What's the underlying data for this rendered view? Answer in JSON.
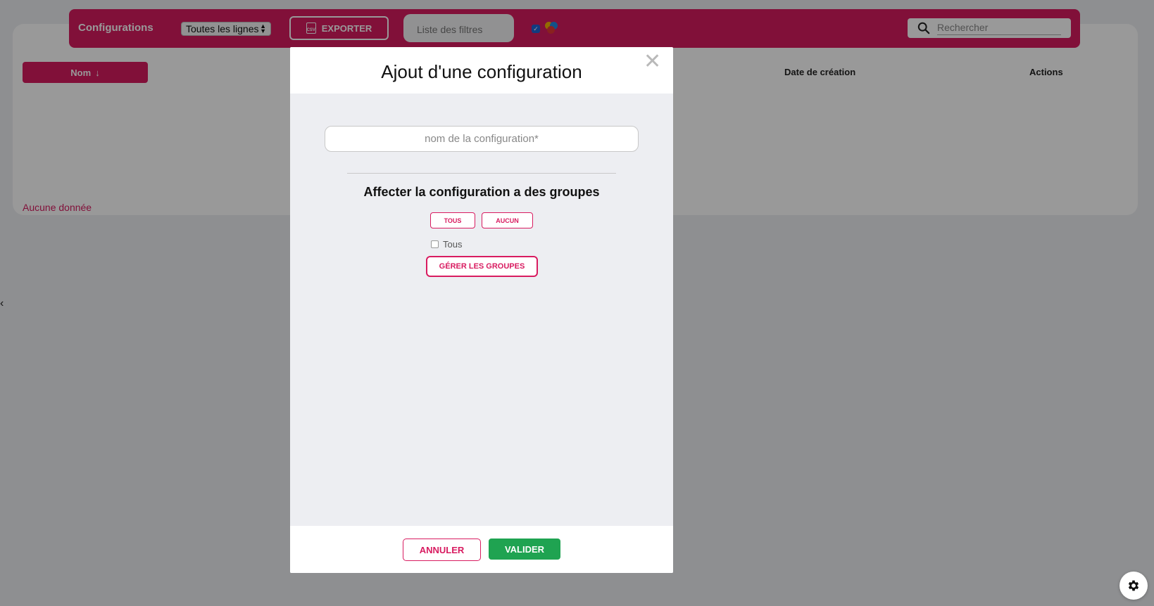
{
  "header": {
    "title": "Configurations",
    "lines_select": "Toutes les lignes",
    "export_label": "EXPORTER",
    "csv_icon_text": "CSV",
    "filters_placeholder": "Liste des filtres",
    "search_placeholder": "Rechercher"
  },
  "table": {
    "columns": [
      "Nom",
      "Date de création",
      "Actions"
    ],
    "sort_indicator": "↓",
    "empty_text": "Aucune donnée"
  },
  "modal": {
    "title": "Ajout d'une configuration",
    "close_glyph": "✕",
    "name_placeholder": "nom de la configuration*",
    "assign_title": "Affecter la configuration a des groupes",
    "select_all_label": "TOUS",
    "select_none_label": "AUCUN",
    "group_option": "Tous",
    "manage_groups_label": "GÉRER LES GROUPES",
    "cancel_label": "ANNULER",
    "submit_label": "VALIDER"
  },
  "colors": {
    "brand": "#d81b60",
    "success": "#1fa351"
  },
  "icons": {
    "search": "search-icon",
    "settings": "gear-icon",
    "close": "close-icon",
    "export": "csv-file-icon"
  }
}
